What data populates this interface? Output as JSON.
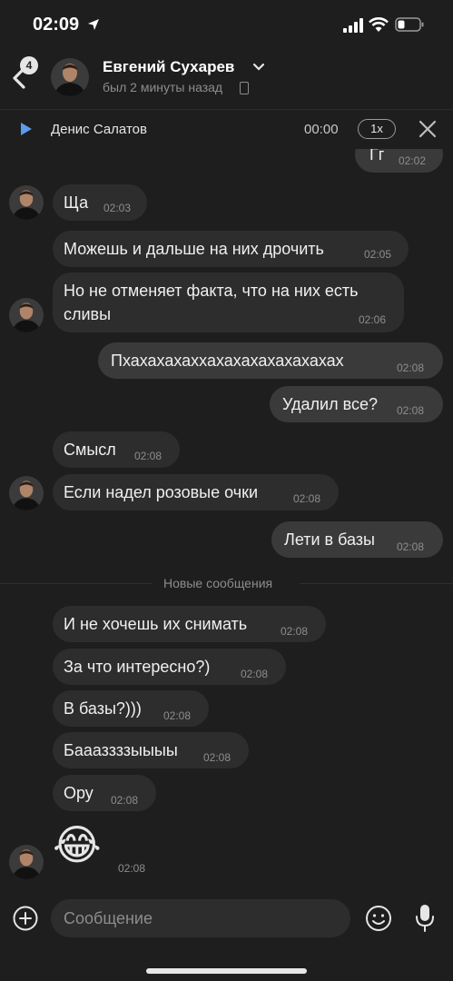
{
  "status_bar": {
    "time": "02:09"
  },
  "header": {
    "back_badge": "4",
    "contact_name": "Евгений Сухарев",
    "last_seen": "был 2 минуты назад"
  },
  "player": {
    "title": "Денис Салатов",
    "time": "00:00",
    "speed": "1x"
  },
  "messages": [
    {
      "text": "Гг",
      "time": "02:02",
      "dir": "out"
    },
    {
      "text": "Ща",
      "time": "02:03",
      "dir": "in"
    },
    {
      "text": "Можешь и дальше на них дрочить",
      "time": "02:05",
      "dir": "in"
    },
    {
      "text": "Но не отменяет факта, что на них есть сливы",
      "time": "02:06",
      "dir": "in"
    },
    {
      "text": "Пхахахахаххахахахахахахахах",
      "time": "02:08",
      "dir": "out"
    },
    {
      "text": "Удалил все?",
      "time": "02:08",
      "dir": "out"
    },
    {
      "text": "Смысл",
      "time": "02:08",
      "dir": "in"
    },
    {
      "text": "Если надел розовые очки",
      "time": "02:08",
      "dir": "in"
    },
    {
      "text": "Лети в базы",
      "time": "02:08",
      "dir": "out"
    },
    {
      "text": "И не хочешь их снимать",
      "time": "02:08",
      "dir": "in"
    },
    {
      "text": "За что интересно?)",
      "time": "02:08",
      "dir": "in"
    },
    {
      "text": "В базы?)))",
      "time": "02:08",
      "dir": "in"
    },
    {
      "text": "Баааззззыыыы",
      "time": "02:08",
      "dir": "in"
    },
    {
      "text": "Ору",
      "time": "02:08",
      "dir": "in"
    },
    {
      "text": "😂",
      "time": "02:08",
      "dir": "in"
    }
  ],
  "divider": "Новые сообщения",
  "composer": {
    "placeholder": "Сообщение"
  }
}
